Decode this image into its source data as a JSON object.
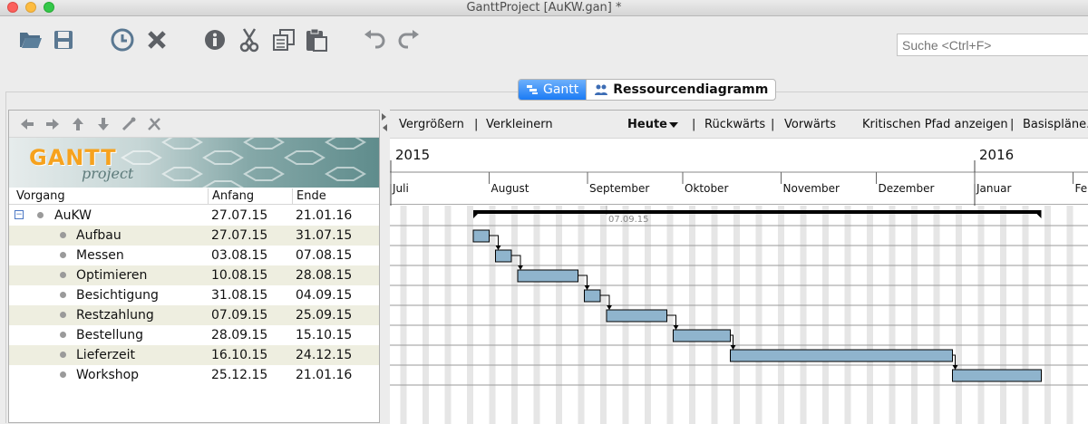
{
  "window": {
    "title": "GanttProject [AuKW.gan] *"
  },
  "toolbar": {
    "buttons": [
      {
        "icon": "open-folder-icon"
      },
      {
        "icon": "save-icon"
      },
      {
        "icon": "clock-icon"
      },
      {
        "icon": "delete-icon"
      },
      {
        "icon": "info-icon"
      },
      {
        "icon": "cut-icon"
      },
      {
        "icon": "copy-icon"
      },
      {
        "icon": "paste-icon"
      },
      {
        "icon": "undo-icon"
      },
      {
        "icon": "redo-icon"
      }
    ],
    "search_placeholder": "Suche <Ctrl+F>"
  },
  "tabs": {
    "gantt": "Gantt",
    "resources": "Ressourcendiagramm"
  },
  "logo": {
    "text": "GANTT",
    "subtext": "project"
  },
  "columns": {
    "name": "Vorgang",
    "start": "Anfang",
    "end": "Ende"
  },
  "tasks": [
    {
      "name": "AuKW",
      "start": "27.07.15",
      "end": "21.01.16"
    },
    {
      "name": "Aufbau",
      "start": "27.07.15",
      "end": "31.07.15"
    },
    {
      "name": "Messen",
      "start": "03.08.15",
      "end": "07.08.15"
    },
    {
      "name": "Optimieren",
      "start": "10.08.15",
      "end": "28.08.15"
    },
    {
      "name": "Besichtigung",
      "start": "31.08.15",
      "end": "04.09.15"
    },
    {
      "name": "Restzahlung",
      "start": "07.09.15",
      "end": "25.09.15"
    },
    {
      "name": "Bestellung",
      "start": "28.09.15",
      "end": "15.10.15"
    },
    {
      "name": "Lieferzeit",
      "start": "16.10.15",
      "end": "24.12.15"
    },
    {
      "name": "Workshop",
      "start": "25.12.15",
      "end": "21.01.16"
    }
  ],
  "chart_toolbar": {
    "zoom_in": "Vergrößern",
    "zoom_out": "Verkleinern",
    "today": "Heute",
    "back": "Rückwärts",
    "forward": "Vorwärts",
    "critical_path": "Kritischen Pfad anzeigen",
    "baselines": "Basispläne...",
    "separator": "|"
  },
  "timeline": {
    "years": [
      "2015",
      "2016"
    ],
    "months": [
      "Juli",
      "August",
      "September",
      "Oktober",
      "November",
      "Dezember",
      "Januar",
      "Feb"
    ],
    "today_marker": "07.09.15"
  },
  "colors": {
    "bar_fill": "#8fb4cd",
    "summary": "#000000",
    "accent": "#1b7bf5"
  }
}
